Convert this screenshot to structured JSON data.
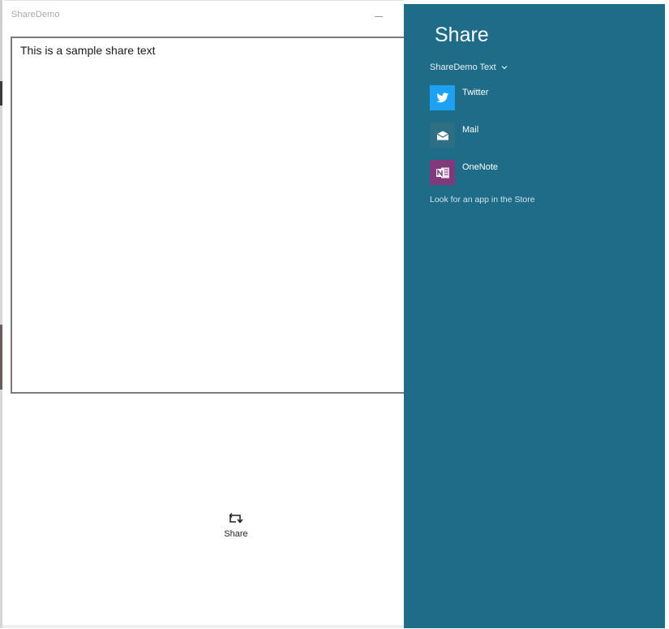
{
  "app": {
    "title": "ShareDemo",
    "text_content": "This is a sample share text",
    "share_button_label": "Share"
  },
  "share_pane": {
    "title": "Share",
    "source": "ShareDemo Text",
    "targets": [
      {
        "label": "Twitter",
        "icon": "twitter-icon",
        "color": "#1da1f2"
      },
      {
        "label": "Mail",
        "icon": "mail-icon",
        "color": "#2f6f84"
      },
      {
        "label": "OneNote",
        "icon": "onenote-icon",
        "color": "#80397b"
      }
    ],
    "store_link": "Look for an app in the Store"
  },
  "colors": {
    "pane_background": "#1e6c87",
    "window_background": "#ffffff"
  }
}
